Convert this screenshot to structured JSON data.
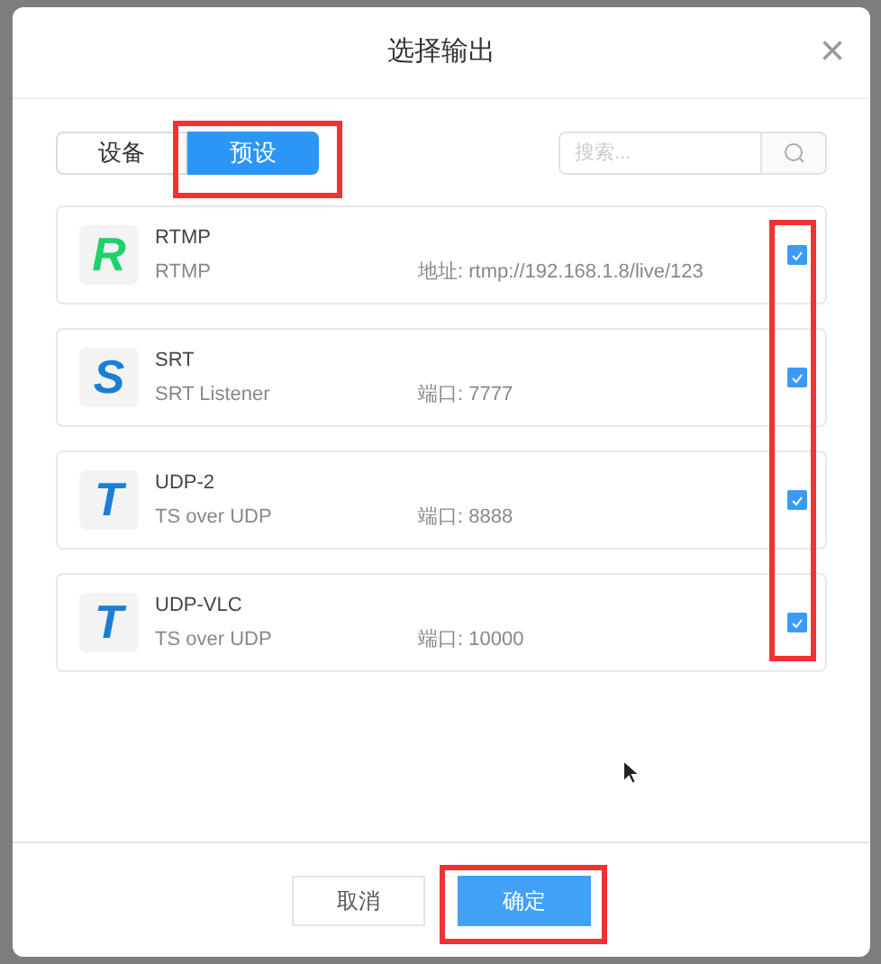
{
  "dialog": {
    "title": "选择输出",
    "close": "×"
  },
  "tabs": [
    {
      "label": "设备",
      "selected": false
    },
    {
      "label": "预设",
      "selected": true
    }
  ],
  "search": {
    "placeholder": "搜索..."
  },
  "outputs": [
    {
      "logo": "R",
      "color": "#1fd16b",
      "name": "RTMP",
      "type": "RTMP",
      "detail": "地址: rtmp://192.168.1.8/live/123",
      "checked": true
    },
    {
      "logo": "S",
      "color": "#1a7fd4",
      "name": "SRT",
      "type": "SRT Listener",
      "detail": "端口: 7777",
      "checked": true
    },
    {
      "logo": "T",
      "color": "#1a7fd4",
      "name": "UDP-2",
      "type": "TS over UDP",
      "detail": "端口: 8888",
      "checked": true
    },
    {
      "logo": "T",
      "color": "#1a7fd4",
      "name": "UDP-VLC",
      "type": "TS over UDP",
      "detail": "端口: 10000",
      "checked": true
    }
  ],
  "buttons": {
    "cancel": "取消",
    "confirm": "确定"
  }
}
